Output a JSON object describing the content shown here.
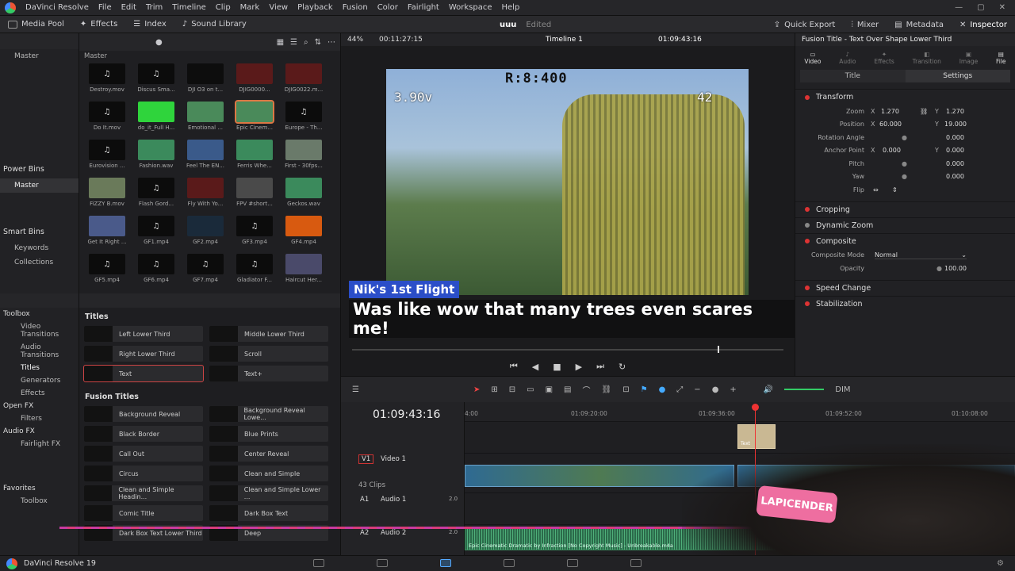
{
  "app": {
    "name": "DaVinci Resolve",
    "footer": "DaVinci Resolve 19"
  },
  "menu": [
    "File",
    "Edit",
    "Trim",
    "Timeline",
    "Clip",
    "Mark",
    "View",
    "Playback",
    "Fusion",
    "Color",
    "Fairlight",
    "Workspace",
    "Help"
  ],
  "toolbar": {
    "media_pool": "Media Pool",
    "effects": "Effects",
    "index": "Index",
    "sound_library": "Sound Library",
    "project": "uuu",
    "status": "Edited",
    "quick_export": "Quick Export",
    "mixer": "Mixer",
    "metadata": "Metadata",
    "inspector": "Inspector"
  },
  "bins": {
    "master": "Master",
    "power_bins": "Power Bins",
    "power_master": "Master",
    "smart_bins": "Smart Bins",
    "keywords": "Keywords",
    "collections": "Collections"
  },
  "media": {
    "header": "Master",
    "clips": [
      "Destroy.mov",
      "Discus Sma...",
      "DJI O3 on t...",
      "DJIG0000...",
      "DJIG0022.m...",
      "Do It.mov",
      "do_it_Full H...",
      "Emotional ...",
      "Epic Cinem...",
      "Europe - Th...",
      "Eurovision ...",
      "Fashion.wav",
      "Feel The EN...",
      "Ferris Whe...",
      "First - 30fps...",
      "FiZZY B.mov",
      "Flash Gord...",
      "Fly With Yo...",
      "FPV #short...",
      "Geckos.wav",
      "Get It Right ...",
      "GF1.mp4",
      "GF2.mp4",
      "GF3.mp4",
      "GF4.mp4",
      "GF5.mp4",
      "GF6.mp4",
      "GF7.mp4",
      "Gladiator F...",
      "Haircut Her..."
    ]
  },
  "fxnav": [
    "Toolbox",
    "Video Transitions",
    "Audio Transitions",
    "Titles",
    "Generators",
    "Effects",
    "Open FX",
    "Filters",
    "Audio FX",
    "Fairlight FX",
    "Favorites",
    "Toolbox"
  ],
  "fx": {
    "titles_header": "Titles",
    "titles": [
      "Left Lower Third",
      "Middle Lower Third",
      "Right Lower Third",
      "Scroll",
      "Text",
      "Text+"
    ],
    "fusion_header": "Fusion Titles",
    "fusion": [
      "Background Reveal",
      "Background Reveal Lowe...",
      "Black Border",
      "Blue Prints",
      "Call Out",
      "Center Reveal",
      "Circus",
      "Clean and Simple",
      "Clean and Simple Headin...",
      "Clean and Simple Lower ...",
      "Comic Title",
      "Dark Box Text",
      "Dark Box Text Lower Third",
      "Deep"
    ]
  },
  "viewer": {
    "zoom": "44%",
    "src_tc": "00:11:27:15",
    "timeline": "Timeline 1",
    "tc": "01:09:43:16",
    "osd_top": "R:8:400",
    "osd_left": "3.90v",
    "osd_right": "42",
    "lower_title": "Nik's 1st Flight",
    "lower_sub": "Was like wow that many trees even scares me!"
  },
  "inspector": {
    "title": "Fusion Title - Text Over Shape Lower Third",
    "tabs": [
      "Video",
      "Audio",
      "Effects",
      "Transition",
      "Image",
      "File"
    ],
    "subtabs": [
      "Title",
      "Settings"
    ],
    "transform": "Transform",
    "zoom_label": "Zoom",
    "zoom_x": "1.270",
    "zoom_y": "1.270",
    "position_label": "Position",
    "pos_x": "60.000",
    "pos_y": "19.000",
    "rotation_label": "Rotation Angle",
    "rotation": "0.000",
    "anchor_label": "Anchor Point",
    "anchor_x": "0.000",
    "anchor_y": "0.000",
    "pitch_label": "Pitch",
    "pitch": "0.000",
    "yaw_label": "Yaw",
    "yaw": "0.000",
    "flip_label": "Flip",
    "cropping": "Cropping",
    "dynamic_zoom": "Dynamic Zoom",
    "composite": "Composite",
    "composite_mode_label": "Composite Mode",
    "composite_mode": "Normal",
    "opacity_label": "Opacity",
    "opacity": "100.00",
    "speed_change": "Speed Change",
    "stabilization": "Stabilization",
    "x": "X",
    "y": "Y"
  },
  "timeline": {
    "tc": "01:09:43:16",
    "ruler": [
      "4:00",
      "01:09:20:00",
      "01:09:36:00",
      "01:09:52:00",
      "01:10:08:00"
    ],
    "v1": "V1",
    "v1_name": "Video 1",
    "clips": "43 Clips",
    "a1": "A1",
    "a1_name": "Audio 1",
    "a1_vol": "2.0",
    "a2": "A2",
    "a2_name": "Audio 2",
    "a2_vol": "2.0",
    "title_clip": "Text",
    "audio_clip": "Epic Cinematic Dramatic by Infraction [No Copyright Music] - Unbreakable.m4a",
    "dim": "DIM"
  },
  "overlay": {
    "badge": "LAPICENDER"
  }
}
